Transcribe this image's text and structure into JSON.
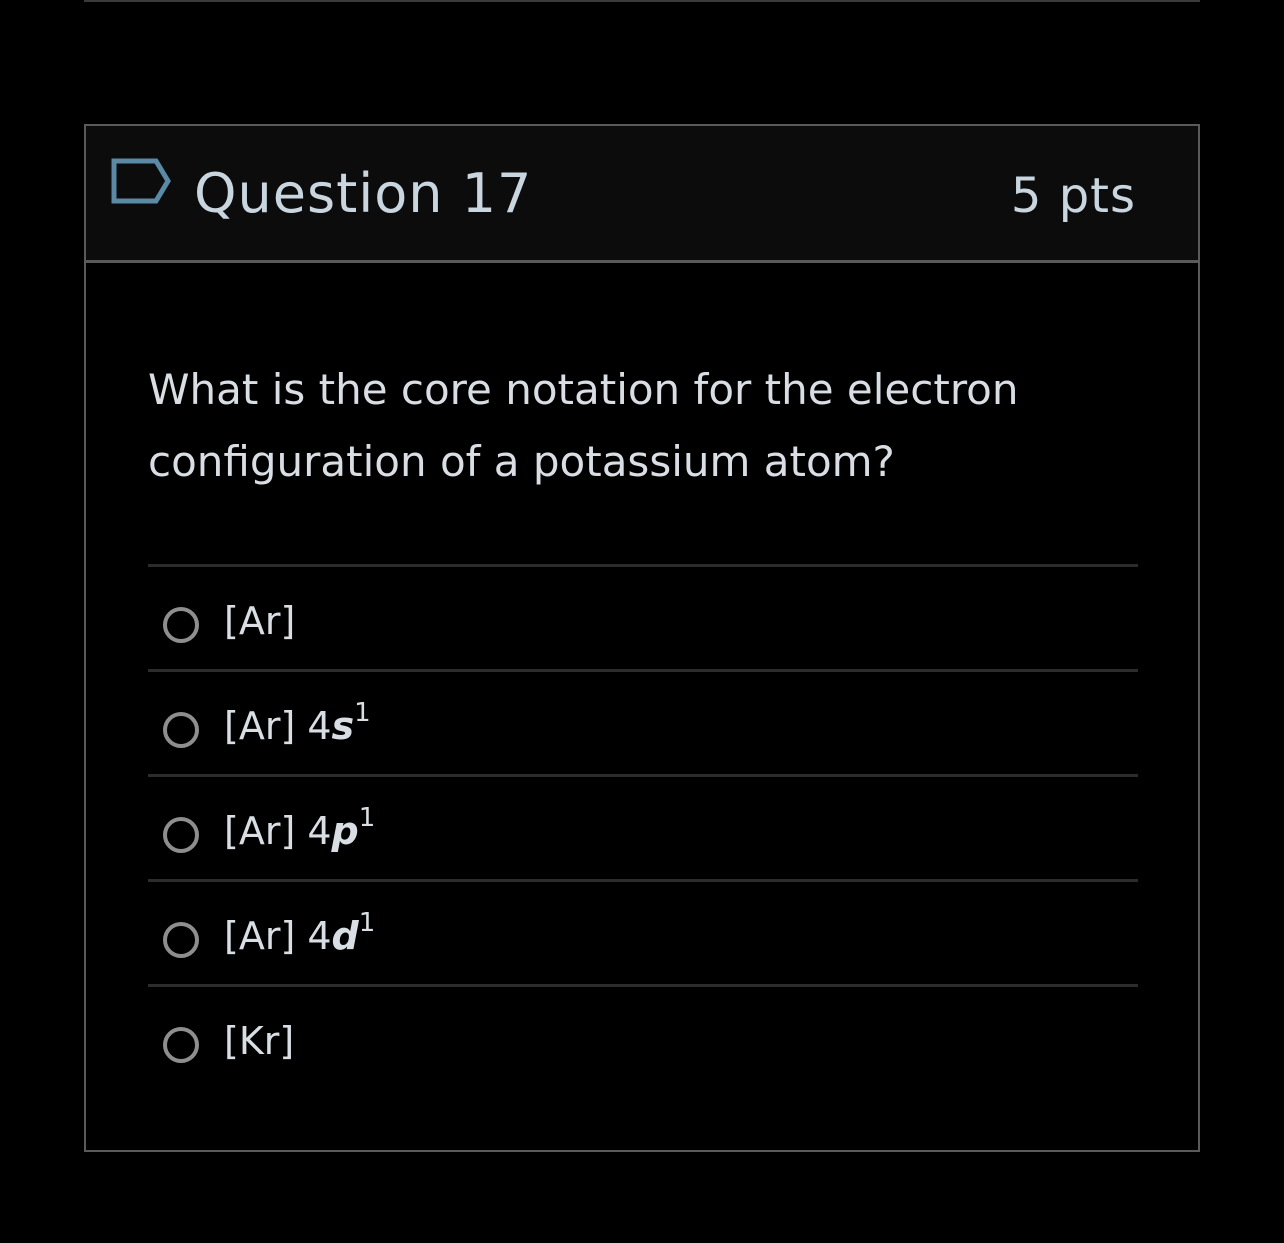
{
  "question": {
    "title": "Question 17",
    "points": "5 pts",
    "text": "What is the core notation for the electron configuration of a potassium atom?",
    "flag_icon": "flag-outline-icon"
  },
  "answers": [
    {
      "core": "[Ar]",
      "prefix": "",
      "orbital": "",
      "exponent": ""
    },
    {
      "core": "[Ar]",
      "prefix": " 4",
      "orbital": "s",
      "exponent": "1"
    },
    {
      "core": "[Ar]",
      "prefix": " 4",
      "orbital": "p",
      "exponent": "1"
    },
    {
      "core": "[Ar]",
      "prefix": " 4",
      "orbital": "d",
      "exponent": "1"
    },
    {
      "core": "[Kr]",
      "prefix": "",
      "orbital": "",
      "exponent": ""
    }
  ],
  "colors": {
    "background": "#000000",
    "header_background": "#0c0c0c",
    "card_border": "#5a5a5a",
    "title_text": "#c9d6df",
    "body_text": "#d8dee3",
    "radio_border": "#8e8e8e",
    "flag_stroke": "#5a8aa6"
  }
}
